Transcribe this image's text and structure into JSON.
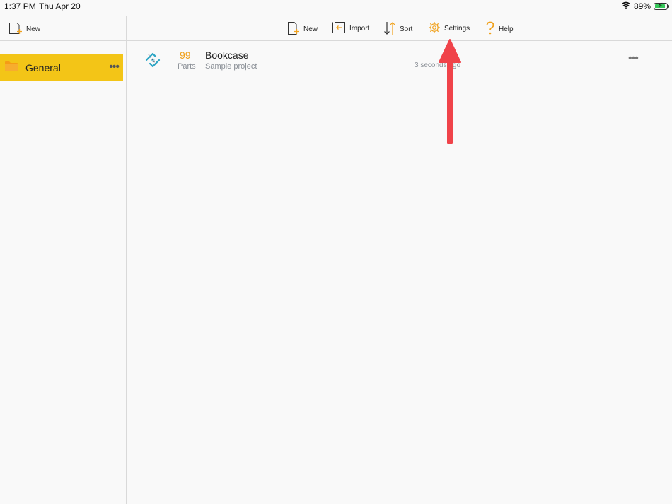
{
  "status": {
    "time": "1:37 PM",
    "date": "Thu Apr 20",
    "battery": "89%"
  },
  "sidebar": {
    "new_label": "New",
    "folders": [
      {
        "label": "General",
        "more": "•••"
      }
    ]
  },
  "toolbar": {
    "new_label": "New",
    "import_label": "Import",
    "sort_label": "Sort",
    "settings_label": "Settings",
    "help_label": "Help"
  },
  "projects": [
    {
      "parts_count": "99",
      "parts_label": "Parts",
      "title": "Bookcase",
      "subtitle": "Sample project",
      "modified": "3 seconds ago",
      "more": "•••"
    }
  ],
  "colors": {
    "accent": "#f0a11c",
    "folder_highlight": "#f3c517",
    "annotation_arrow": "#f0434a"
  }
}
